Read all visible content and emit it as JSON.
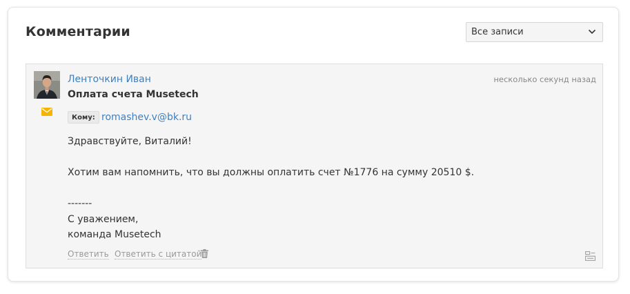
{
  "comments_section": {
    "title": "Комментарии",
    "filter": {
      "selected": "Все записи",
      "icon": "chevron-down-icon"
    }
  },
  "comment": {
    "author": "Ленточкин Иван",
    "timestamp": "несколько секунд назад",
    "subject": "Оплата счета Musetech",
    "to_label": "Кому:",
    "to_email": "romashev.v@bk.ru",
    "body_lines": [
      "Здравствуйте, Виталий!",
      "",
      "Хотим вам напомнить, что вы должны оплатить счет №1776 на сумму 20510 $.",
      "",
      "-------",
      "С уважением,",
      "команда Musetech"
    ],
    "actions": {
      "reply": "Ответить",
      "reply_quote": "Ответить с цитатой"
    },
    "icons": {
      "channel": "envelope-icon",
      "delete": "trash-icon",
      "details": "details-icon"
    },
    "colors": {
      "link": "#3f7fbf",
      "envelope": "#f5b400"
    }
  }
}
